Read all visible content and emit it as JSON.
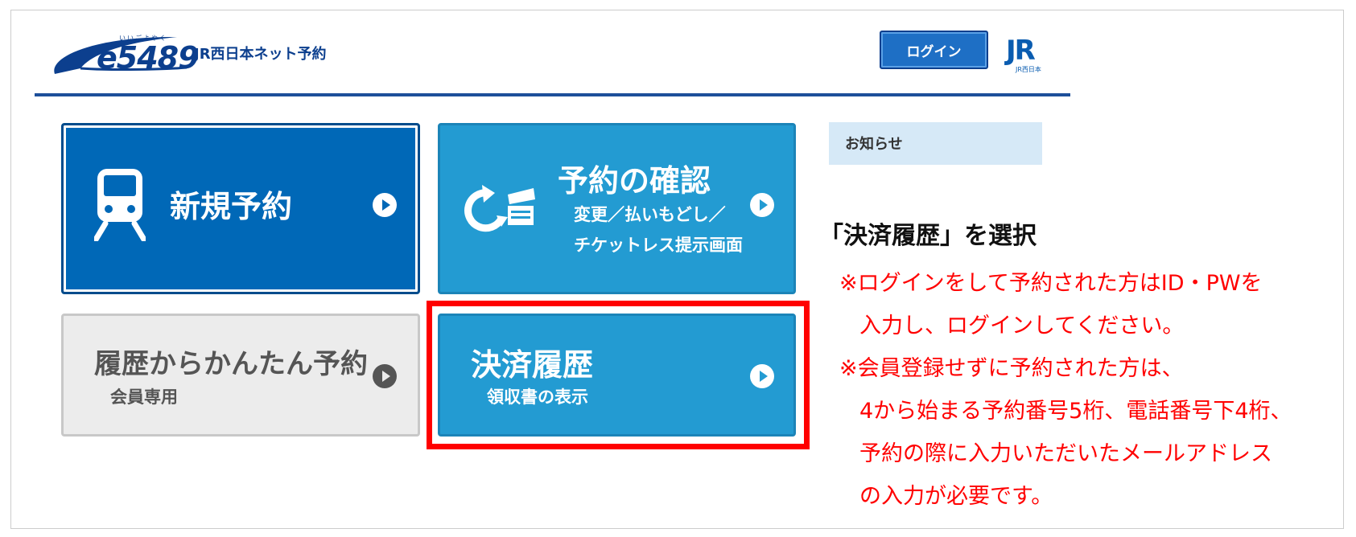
{
  "header": {
    "logo_text": "e5489",
    "logo_sub": "いいごよやく",
    "service_name": "JR西日本ネット予約",
    "login_label": "ログイン",
    "jr_logo": "JR",
    "jr_logo_sub": "JR西日本"
  },
  "menu": {
    "new_reservation": {
      "title": "新規予約",
      "icon": "train-icon"
    },
    "check_reservation": {
      "title": "予約の確認",
      "sub1": "変更／払いもどし／",
      "sub2": "チケットレス提示画面",
      "icon": "refresh-ticket-icon"
    },
    "history_reservation": {
      "title": "履歴からかんたん予約",
      "sub": "会員専用"
    },
    "payment_history": {
      "title": "決済履歴",
      "sub": "領収書の表示"
    }
  },
  "notice": {
    "title": "お知らせ"
  },
  "annotation": {
    "instruction": "「決済履歴」を選択",
    "notes": [
      "※ログインをして予約された方はID・PWを",
      "入力し、ログインしてください。",
      "※会員登録せずに予約された方は、",
      "4から始まる予約番号5桁、電話番号下4桁、",
      "予約の際に入力いただいたメールアドレス",
      "の入力が必要です。"
    ]
  },
  "colors": {
    "brand_navy": "#0c3f8e",
    "tile_dark_blue": "#0068b7",
    "tile_light_blue": "#239bd2",
    "tile_gray": "#ececec",
    "highlight_red": "#ff0000",
    "notice_bg": "#d6e9f7"
  }
}
